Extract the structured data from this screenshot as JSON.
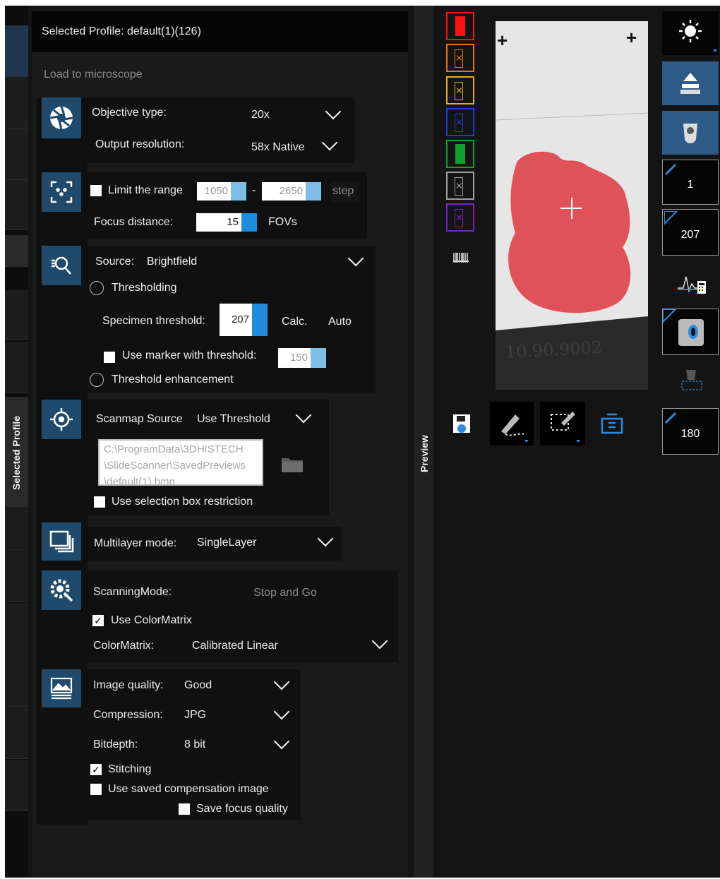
{
  "vertical_tabs": {
    "left": "Selected Profile",
    "right": "Preview"
  },
  "header": {
    "title": "Selected Profile: default(1)(126)",
    "load_link": "Load to microscope"
  },
  "objective": {
    "objective_label": "Objective type:",
    "objective_value": "20x",
    "resolution_label": "Output resolution:",
    "resolution_value": "58x Native"
  },
  "range": {
    "limit_label": "Limit the range",
    "from": "1050",
    "dash": "-",
    "to": "2650",
    "step_label": "step",
    "focus_label": "Focus distance:",
    "focus_value": "15",
    "focus_unit": "FOVs"
  },
  "source": {
    "source_label": "Source:",
    "source_value": "Brightfield",
    "thresholding_label": "Thresholding",
    "specimen_threshold_label": "Specimen threshold:",
    "specimen_threshold_value": "207",
    "calc_label": "Calc.",
    "auto_label": "Auto",
    "marker_label": "Use marker with threshold:",
    "marker_value": "150",
    "enhancement_label": "Threshold enhancement"
  },
  "scanmap": {
    "source_label": "Scanmap Source",
    "source_value": "Use Threshold",
    "path_lines": [
      "C:\\ProgramData\\3DHISTECH",
      "\\SlideScanner\\SavedPreviews",
      "\\default(1).bmp"
    ],
    "selection_label": "Use selection box restriction"
  },
  "multilayer": {
    "label": "Multilayer mode:",
    "value": "SingleLayer"
  },
  "scanning": {
    "mode_label": "ScanningMode:",
    "mode_value": "Stop and Go",
    "colormatrix_check_label": "Use ColorMatrix",
    "colormatrix_label": "ColorMatrix:",
    "colormatrix_value": "Calibrated Linear"
  },
  "image": {
    "quality_label": "Image quality:",
    "quality_value": "Good",
    "compression_label": "Compression:",
    "compression_value": "JPG",
    "bitdepth_label": "Bitdepth:",
    "bitdepth_value": "8 bit",
    "stitching_label": "Stitching",
    "compensation_label": "Use saved compensation image",
    "focus_quality_label": "Save focus quality"
  },
  "checkboxes": {
    "limit_range": false,
    "use_marker": false,
    "selection_box": false,
    "use_colormatrix": true,
    "stitching": true,
    "compensation": false,
    "focus_quality": false
  },
  "swatches": [
    {
      "color": "#ff1010",
      "crossed": false
    },
    {
      "color": "#e07a10",
      "crossed": true
    },
    {
      "color": "#e0b010",
      "crossed": true
    },
    {
      "color": "#1a3cdc",
      "crossed": true
    },
    {
      "color": "#10a030",
      "crossed": false
    },
    {
      "color": "#a0a0a0",
      "crossed": true
    },
    {
      "color": "#7a20c0",
      "crossed": true
    }
  ],
  "right_panel": {
    "value_1": "1",
    "value_2": "207",
    "value_3": "180"
  },
  "slide_label_text": "10.90.9002",
  "colors": {
    "accent": "#1f8ddc",
    "icon_bg": "#1f4a6b",
    "tissue_mask": "#e0454d"
  }
}
